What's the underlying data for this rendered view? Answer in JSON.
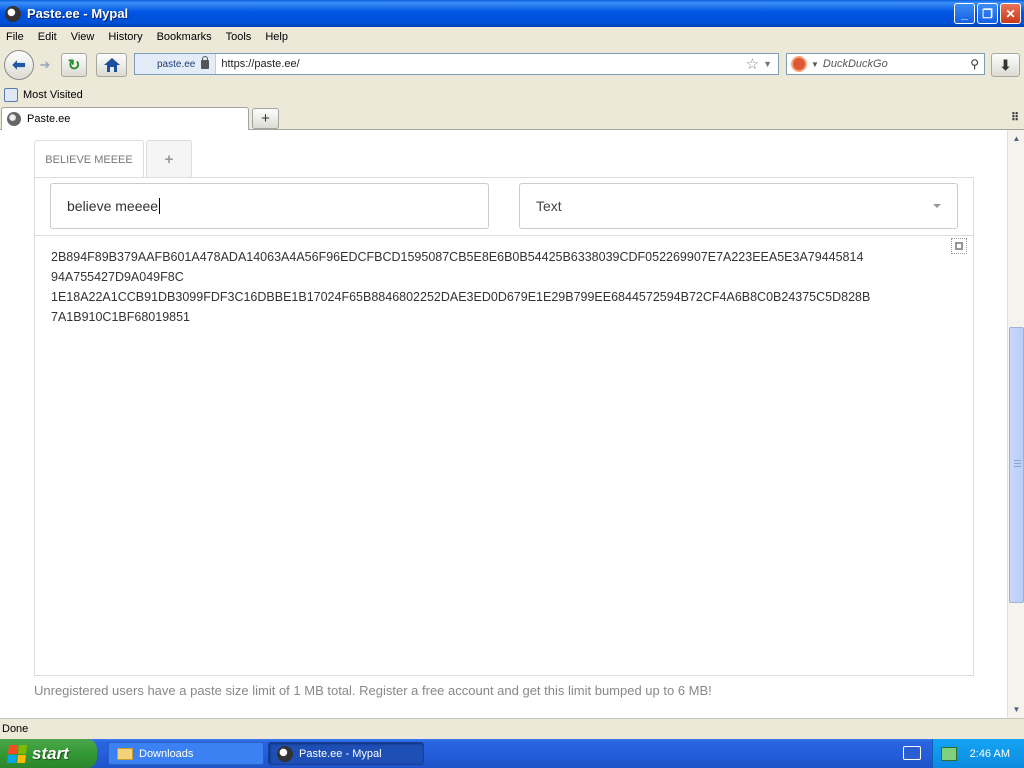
{
  "window": {
    "title": "Paste.ee - Mypal"
  },
  "menu": [
    "File",
    "Edit",
    "View",
    "History",
    "Bookmarks",
    "Tools",
    "Help"
  ],
  "navbar": {
    "identity_label": "paste.ee",
    "url": "https://paste.ee/",
    "search_placeholder": "DuckDuckGo"
  },
  "bookmarks": {
    "most_visited": "Most Visited"
  },
  "tabs": [
    {
      "label": "Paste.ee",
      "active": true
    }
  ],
  "page": {
    "paste_tabs": [
      {
        "label": "BELIEVE MEEEE",
        "active": true
      }
    ],
    "add_tab_label": "+",
    "description_value": "believe meeee",
    "language_value": "Text",
    "paste_lines": [
      "2B894F89B379AAFB601A478ADA14063A4A56F96EDCFBCD1595087CB5E8E6B0B54425B6338039CDF052269907E7A223EEA5E3A79445814",
      "94A755427D9A049F8C",
      "1E18A22A1CCB91DB3099FDF3C16DBBE1B17024F65B8846802252DAE3ED0D679E1E29B799EE6844572594B72CF4A6B8C0B24375C5D828B",
      "7A1B910C1BF68019851"
    ],
    "limit_note": "Unregistered users have a paste size limit of 1 MB total. Register a free account and get this limit bumped up to 6 MB!"
  },
  "status": {
    "text": "Done"
  },
  "taskbar": {
    "start_label": "start",
    "tasks": [
      {
        "label": "Downloads",
        "icon": "folder-icon"
      },
      {
        "label": "Paste.ee - Mypal",
        "icon": "mypal-icon",
        "active": true
      }
    ],
    "clock": "2:46 AM"
  },
  "colors": {
    "titlebar_blue": "#0054e3",
    "taskbar_blue": "#245edb",
    "start_green": "#339933",
    "page_muted_text": "#888888"
  }
}
